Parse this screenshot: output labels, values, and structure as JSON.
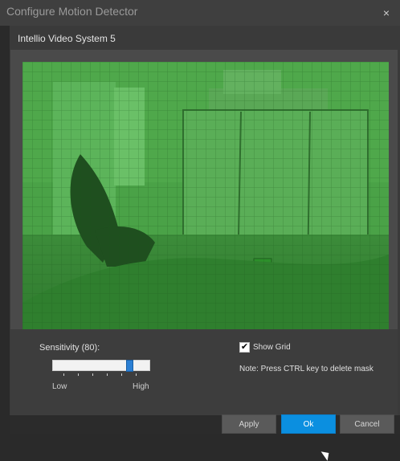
{
  "window": {
    "title": "Configure Motion Detector",
    "subtitle": "Intellio Video System 5",
    "close_glyph": "×"
  },
  "controls": {
    "sensitivity_label": "Sensitivity (80):",
    "sensitivity_value": 80,
    "low_label": "Low",
    "high_label": "High",
    "show_grid_label": "Show Grid",
    "show_grid_checked": true,
    "note": "Note: Press CTRL key to delete mask"
  },
  "buttons": {
    "apply": "Apply",
    "ok": "Ok",
    "cancel": "Cancel"
  },
  "colors": {
    "accent": "#0b8fe0",
    "mask_green": "#3f8a3c"
  },
  "icons": {
    "close": "close-icon",
    "checkmark": "checkmark-icon",
    "cursor": "mouse-cursor-icon"
  }
}
